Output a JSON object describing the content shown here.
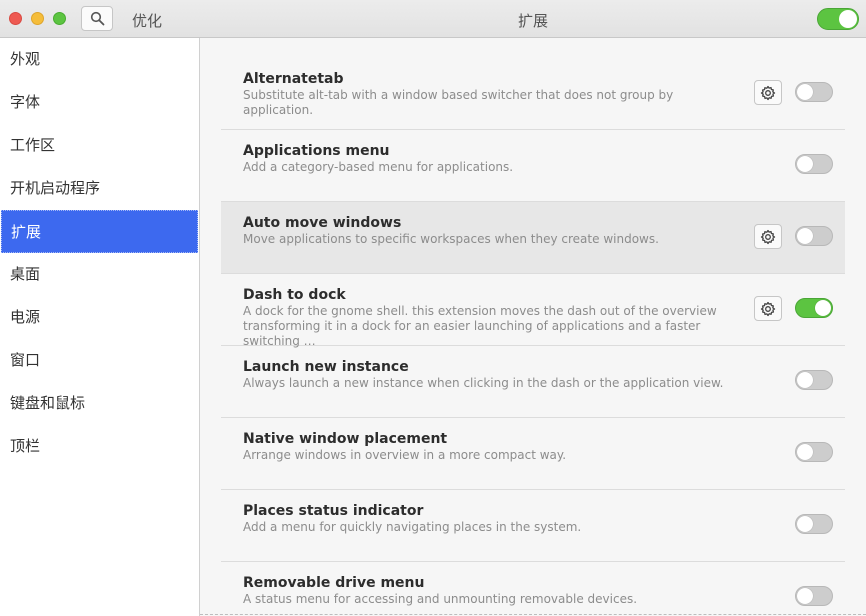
{
  "header": {
    "app_title": "优化",
    "page_title": "扩展",
    "extensions_enabled": true
  },
  "sidebar": {
    "items": [
      {
        "label": "外观"
      },
      {
        "label": "字体"
      },
      {
        "label": "工作区"
      },
      {
        "label": "开机启动程序"
      },
      {
        "label": "扩展",
        "active": true
      },
      {
        "label": "桌面"
      },
      {
        "label": "电源"
      },
      {
        "label": "窗口"
      },
      {
        "label": "键盘和鼠标"
      },
      {
        "label": "顶栏"
      }
    ]
  },
  "extensions": [
    {
      "name": "Alternatetab",
      "description": "Substitute alt-tab with a window based switcher that does not group by application.",
      "settings": true,
      "enabled": false
    },
    {
      "name": "Applications menu",
      "description": "Add a category-based menu for applications.",
      "settings": false,
      "enabled": false
    },
    {
      "name": "Auto move windows",
      "description": "Move applications to specific workspaces when they create windows.",
      "settings": true,
      "enabled": false
    },
    {
      "name": "Dash to dock",
      "description": "A dock for the gnome shell. this extension moves the dash out of the overview\ntransforming it in a dock for an easier launching of applications and a faster switching …",
      "settings": true,
      "enabled": true
    },
    {
      "name": "Launch new instance",
      "description": "Always launch a new instance when clicking in the dash or the application view.",
      "settings": false,
      "enabled": false
    },
    {
      "name": "Native window placement",
      "description": "Arrange windows in overview in a more compact way.",
      "settings": false,
      "enabled": false
    },
    {
      "name": "Places status indicator",
      "description": "Add a menu for quickly navigating places in the system.",
      "settings": false,
      "enabled": false
    },
    {
      "name": "Removable drive menu",
      "description": "A status menu for accessing and unmounting removable devices.",
      "settings": false,
      "enabled": false
    }
  ],
  "colors": {
    "accent": "#3d69ef",
    "toggle_on": "#5cc441",
    "toggle_off": "#cdcdcd"
  }
}
